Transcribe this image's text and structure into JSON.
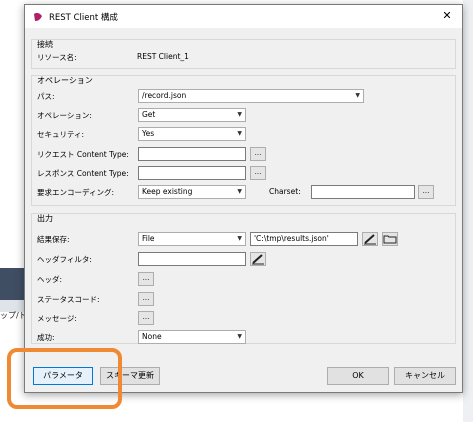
{
  "background": {
    "breadcrumb": "ップ/トリ"
  },
  "dialog": {
    "title": "REST Client 構成",
    "close_glyph": "✕"
  },
  "connection": {
    "header": "接続",
    "resource_label": "リソース名:",
    "resource_value": "REST Client_1"
  },
  "operation": {
    "header": "オペレーション",
    "path_label": "パス:",
    "path_value": "/record.json",
    "operation_label": "オペレーション:",
    "operation_value": "Get",
    "security_label": "セキュリティ:",
    "security_value": "Yes",
    "request_ct_label": "リクエスト Content Type:",
    "request_ct_value": "",
    "response_ct_label": "レスポンス Content Type:",
    "response_ct_value": "",
    "encoding_label": "要求エンコーディング:",
    "encoding_value": "Keep existing",
    "charset_label": "Charset:",
    "charset_value": ""
  },
  "output": {
    "header": "出力",
    "save_label": "結果保存:",
    "save_value": "File",
    "save_path": "'C:\\tmp\\results.json'",
    "header_filter_label": "ヘッダフィルタ:",
    "header_filter_value": "",
    "header_label": "ヘッダ:",
    "status_code_label": "ステータスコード:",
    "message_label": "メッセージ:",
    "success_label": "成功:",
    "success_value": "None"
  },
  "buttons": {
    "params": "パラメータ",
    "schema": "スキーマ更新",
    "ok": "OK",
    "cancel": "キャンセル",
    "dots": "..."
  },
  "colors": {
    "highlight": "#ef8a33",
    "app_icon": "#b0206a"
  }
}
